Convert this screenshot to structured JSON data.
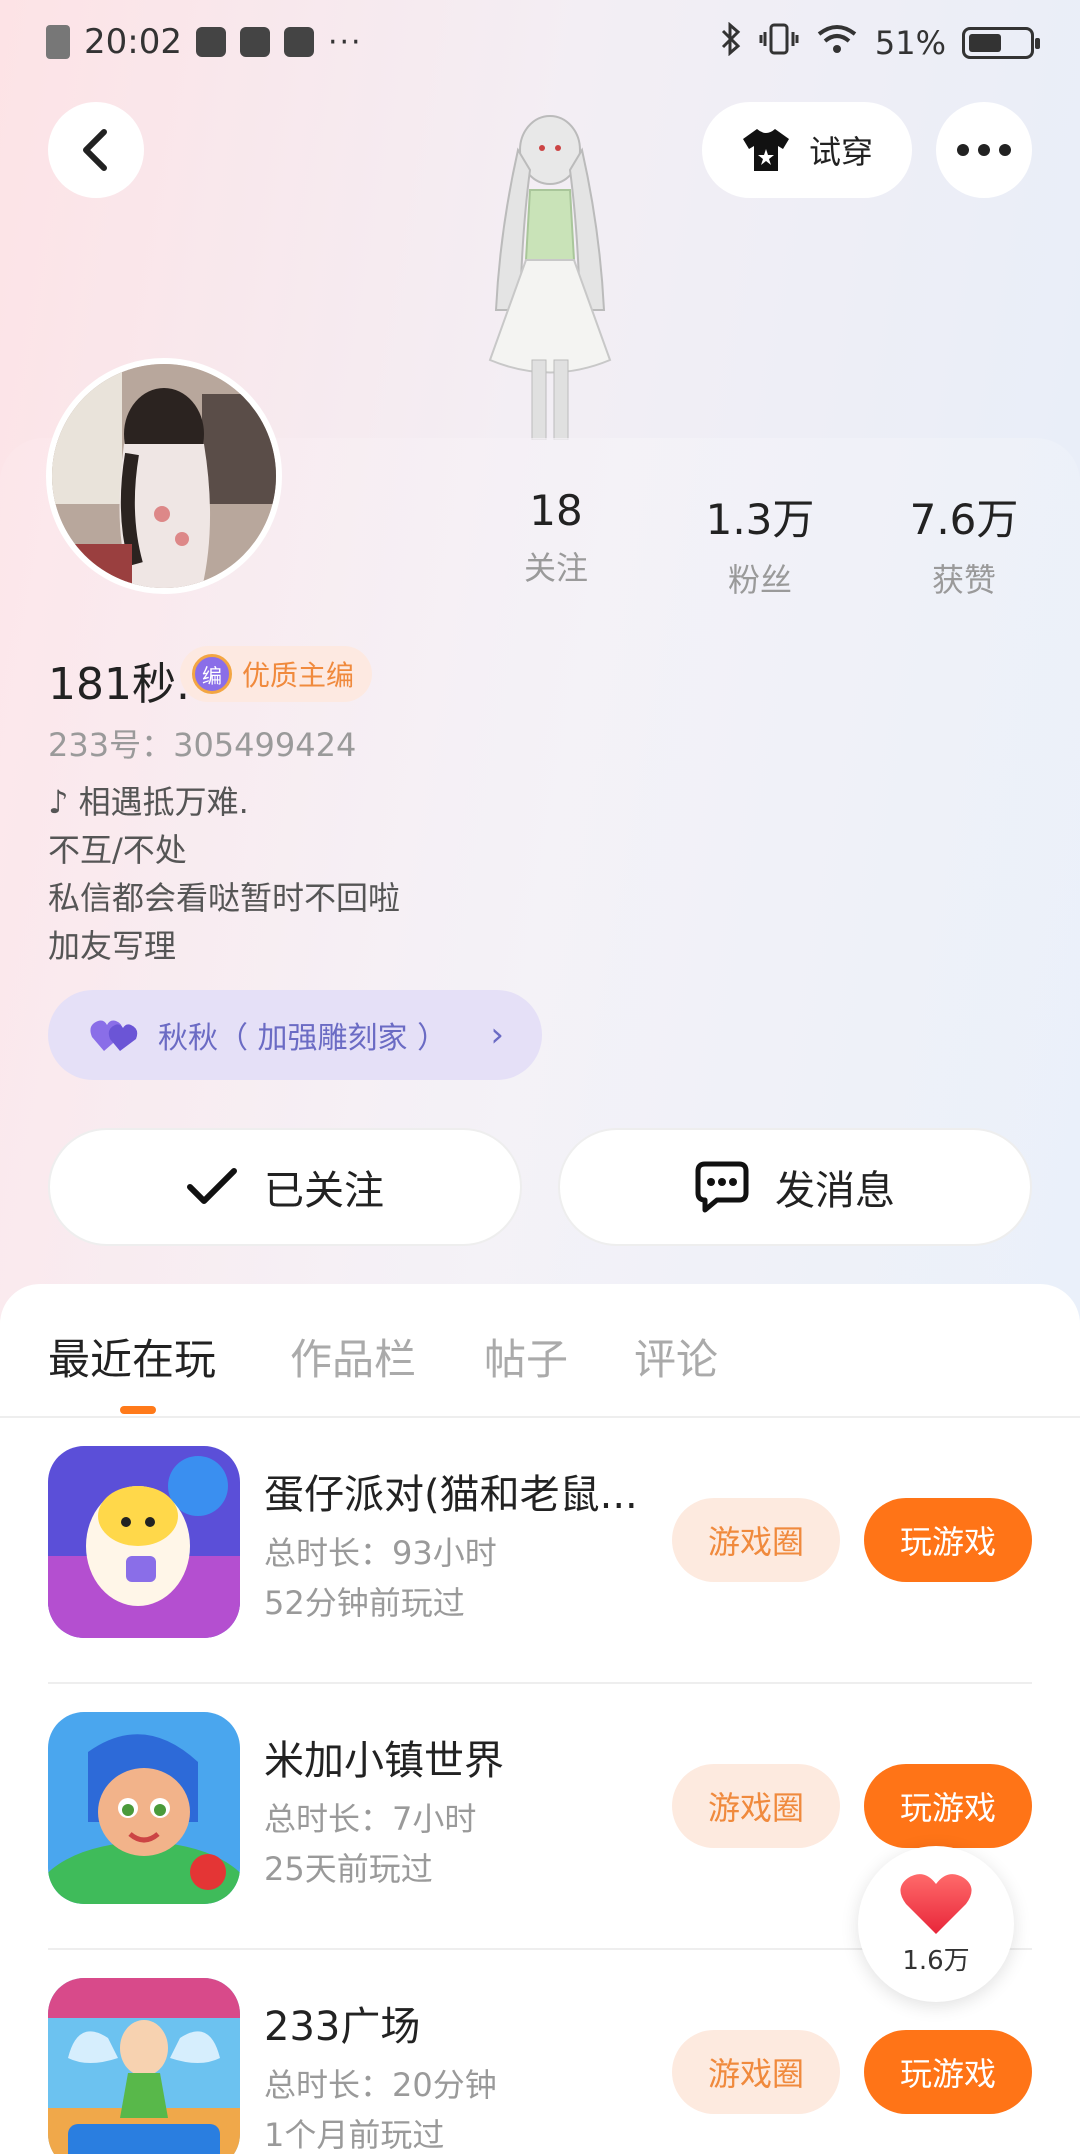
{
  "status_bar": {
    "time": "20:02",
    "more": "···",
    "battery": "51%"
  },
  "header": {
    "tryon_label": "试穿"
  },
  "profile": {
    "username": "181秒.",
    "badge": "优质主编",
    "badge_icon_char": "编",
    "uid": "233号：305499424",
    "bio": [
      "♪ 相遇抵万难.",
      "不互/不处",
      "私信都会看哒暂时不回啦",
      "加友写理"
    ],
    "stats": [
      {
        "value": "18",
        "label": "关注"
      },
      {
        "value": "1.3万",
        "label": "粉丝"
      },
      {
        "value": "7.6万",
        "label": "获赞"
      }
    ],
    "group_chip": "秋秋（ 加强雕刻家 ）",
    "group_arrow": "›"
  },
  "actions": {
    "follow_label": "已关注",
    "message_label": "发消息"
  },
  "tabs": [
    {
      "label": "最近在玩",
      "active": true
    },
    {
      "label": "作品栏",
      "active": false
    },
    {
      "label": "帖子",
      "active": false
    },
    {
      "label": "评论",
      "active": false
    }
  ],
  "games": [
    {
      "title": "蛋仔派对(猫和老鼠...",
      "playtime": "总时长：93小时",
      "last_played": "52分钟前玩过",
      "circle_label": "游戏圈",
      "play_label": "玩游戏"
    },
    {
      "title": "米加小镇世界",
      "playtime": "总时长：7小时",
      "last_played": "25天前玩过",
      "circle_label": "游戏圈",
      "play_label": "玩游戏"
    },
    {
      "title": "233广场",
      "playtime": "总时长：20分钟",
      "last_played": "1个月前玩过",
      "circle_label": "游戏圈",
      "play_label": "玩游戏"
    }
  ],
  "like_float": {
    "count": "1.6万"
  },
  "colors": {
    "accent": "#ff7417",
    "accent_light": "#fdeadf",
    "chip_bg": "#e5e0f7",
    "chip_text": "#6b6bc4"
  }
}
